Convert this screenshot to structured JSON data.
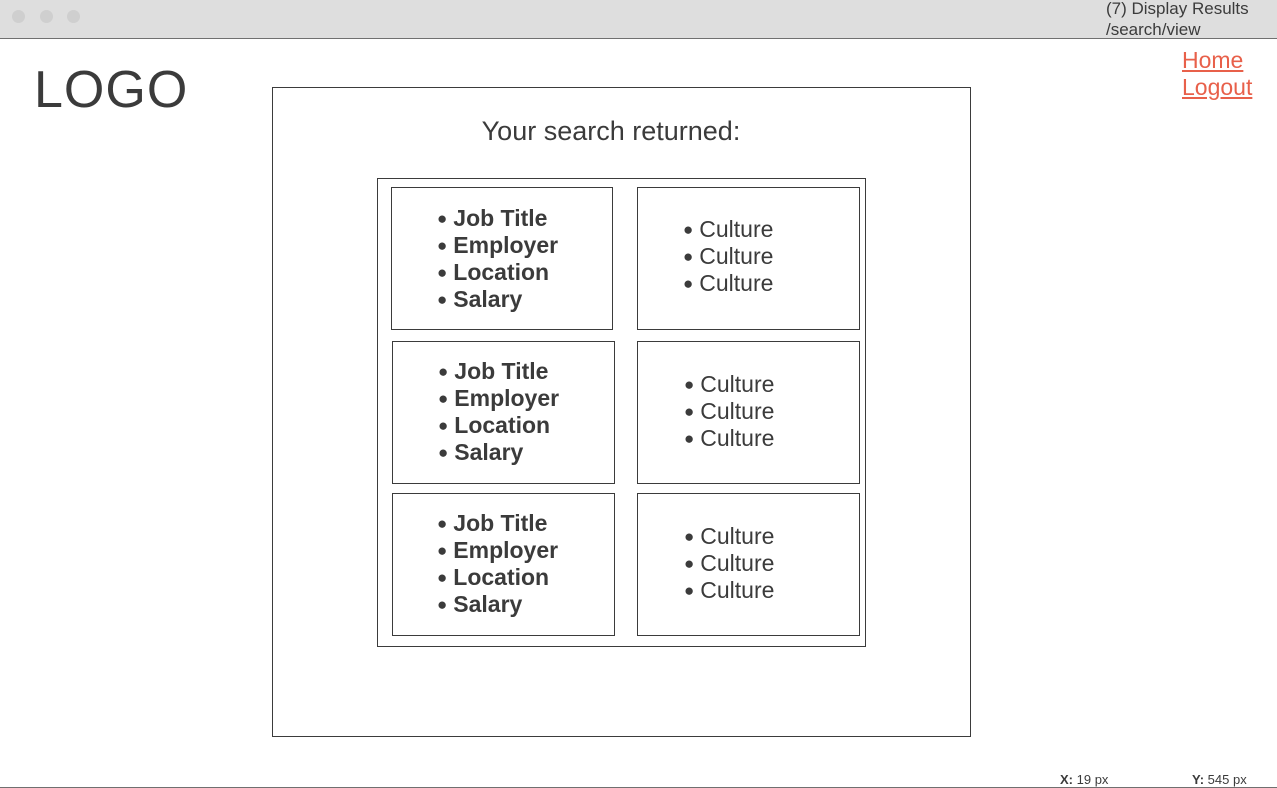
{
  "window": {
    "title_line1": "(7) Display Results",
    "title_line2": "/search/view"
  },
  "logo": "LOGO",
  "nav": {
    "home": "Home",
    "logout": "Logout"
  },
  "heading": "Your search returned:",
  "results": [
    {
      "job": [
        "Job Title",
        "Employer",
        "Location",
        "Salary"
      ],
      "culture": [
        "Culture",
        "Culture",
        "Culture"
      ]
    },
    {
      "job": [
        "Job Title",
        "Employer",
        "Location",
        "Salary"
      ],
      "culture": [
        "Culture",
        "Culture",
        "Culture"
      ]
    },
    {
      "job": [
        "Job Title",
        "Employer",
        "Location",
        "Salary"
      ],
      "culture": [
        "Culture",
        "Culture",
        "Culture"
      ]
    }
  ],
  "bullet": "●",
  "status": {
    "x_label": "X:",
    "x_value": "19 px",
    "y_label": "Y:",
    "y_value": "545 px"
  },
  "colors": {
    "link": "#e8604a",
    "text": "#3b3b3b",
    "titlebar": "#dedede"
  }
}
